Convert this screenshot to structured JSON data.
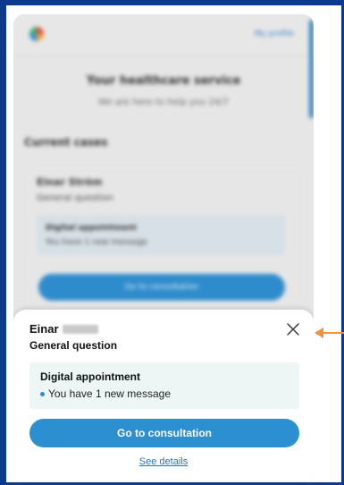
{
  "background_app": {
    "header": {
      "logo_icon": "multicolor-logo-icon",
      "profile_link": "My profile"
    },
    "title": "Your healthcare service",
    "subtitle": "We are here to help you 24/7",
    "section_title": "Current cases",
    "case_card": {
      "name": "Einar Ström",
      "question": "General question",
      "appointment_title": "Digital appointment",
      "appointment_message": "You have 1 new message",
      "button_label": "Go to consultation"
    }
  },
  "sheet": {
    "name": "Einar",
    "question": "General question",
    "close_icon": "close-icon",
    "appointment": {
      "title": "Digital appointment",
      "message": "You have 1 new message"
    },
    "primary_button": "Go to consultation",
    "details_link": "See details"
  },
  "colors": {
    "frame": "#0b3a8f",
    "accent": "#2b8fd0",
    "appointment_bg": "#edf5f5",
    "annotation_arrow": "#f0923b"
  }
}
